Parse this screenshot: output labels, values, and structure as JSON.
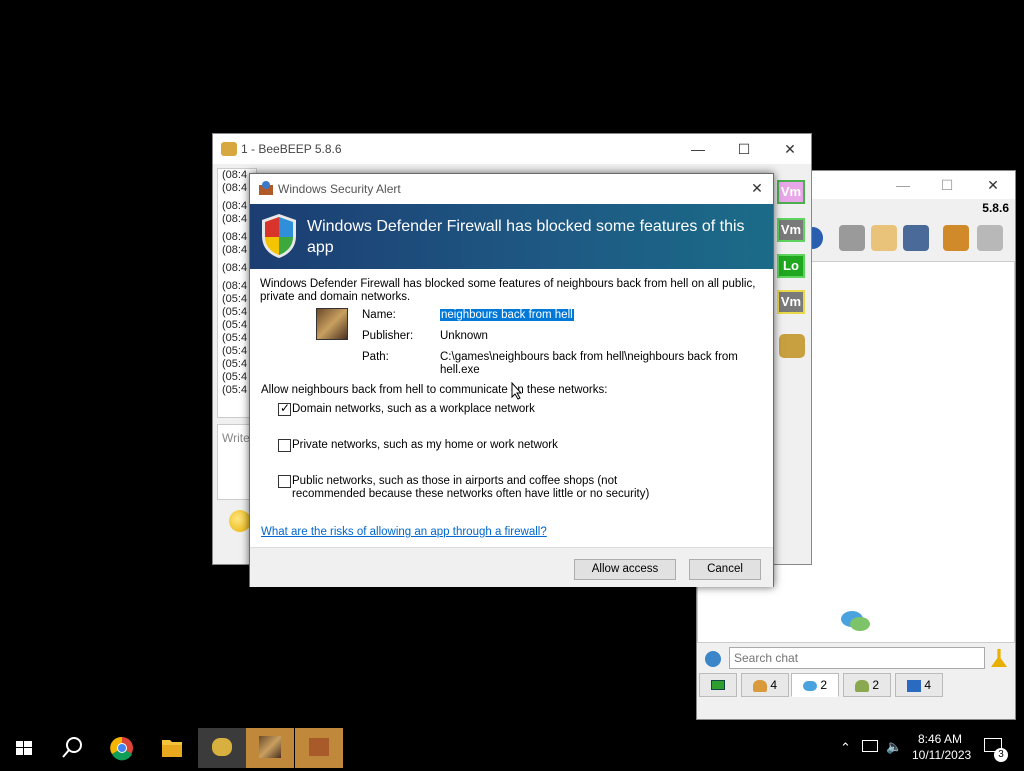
{
  "bee_main": {
    "version": "5.8.6",
    "minimize": "—",
    "maximize": "☐",
    "close": "✕",
    "search_placeholder": "Search chat",
    "tabs": [
      {
        "label": "4"
      },
      {
        "label": "2"
      },
      {
        "label": "2"
      },
      {
        "label": "4"
      }
    ]
  },
  "bee_chat": {
    "title": "1 - BeeBEEP 5.8.6",
    "minimize": "—",
    "maximize": "☐",
    "close": "✕",
    "log_times": [
      "(08:4",
      "(08:4",
      "(08:4",
      "(08:4",
      "(08:4",
      "(08:4",
      "(08:4",
      "(08:4",
      "(05:4",
      "(05:4",
      "(05:4",
      "(05:4",
      "(05:4",
      "(05:4",
      "(05:4",
      "(05:4"
    ],
    "write_placeholder": "Write",
    "side_badges": [
      {
        "label": "Vm",
        "color": "#e9a6e9",
        "border": "#4caf50"
      },
      {
        "label": "Vm",
        "color": "#7a7a7a",
        "border": "#5fd35f"
      },
      {
        "label": "Lo",
        "color": "#1fa81f",
        "border": "#5fd35f"
      },
      {
        "label": "Vm",
        "color": "#7a7a7a",
        "border": "#e8d84a"
      }
    ]
  },
  "dialog": {
    "title": "Windows Security Alert",
    "close": "✕",
    "heading": "Windows Defender Firewall has blocked some features of this app",
    "description": "Windows Defender Firewall has blocked some features of neighbours back from hell on all public, private and domain networks.",
    "name_label": "Name:",
    "name_value": "neighbours back from hell",
    "publisher_label": "Publisher:",
    "publisher_value": "Unknown",
    "path_label": "Path:",
    "path_value": "C:\\games\\neighbours back from hell\\neighbours back from hell.exe",
    "allow_text": "Allow neighbours back from hell to communicate on these networks:",
    "options": [
      {
        "label": "Domain networks, such as a workplace network",
        "checked": true
      },
      {
        "label": "Private networks, such as my home or work network",
        "checked": false
      },
      {
        "label": "Public networks, such as those in airports and coffee shops (not recommended because these networks often have little or no security)",
        "checked": false
      }
    ],
    "link": "What are the risks of allowing an app through a firewall?",
    "allow_button": "Allow access",
    "cancel_button": "Cancel"
  },
  "taskbar": {
    "time": "8:46 AM",
    "date": "10/11/2023",
    "notification_count": "3"
  }
}
